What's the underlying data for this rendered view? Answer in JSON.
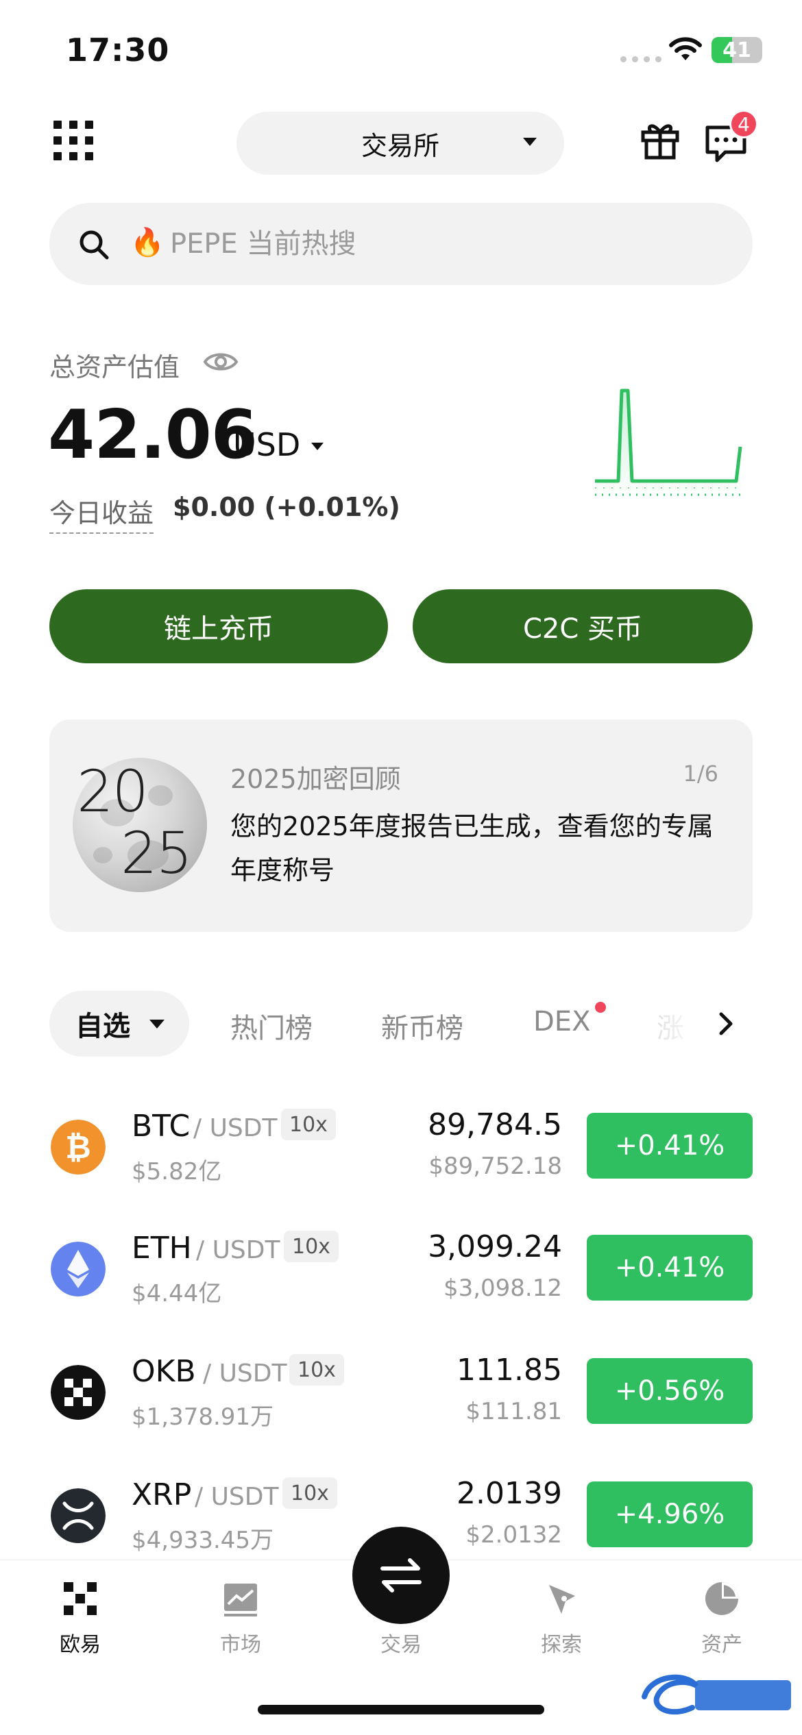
{
  "status_bar": {
    "time": "17:30",
    "battery": "41"
  },
  "header": {
    "mode_label": "交易所",
    "badge_count": "4"
  },
  "search": {
    "placeholder": "PEPE 当前热搜"
  },
  "assets": {
    "label": "总资产估值",
    "value": "42.06",
    "unit": "USD",
    "today_label": "今日收益",
    "today_value": "$0.00 (+0.01%)"
  },
  "actions": {
    "onchain_label": "链上充币",
    "c2c_label": "C2C 买币"
  },
  "promo": {
    "year_a": "20",
    "year_b": "25",
    "title": "2025加密回顾",
    "page": "1/6",
    "text": "您的2025年度报告已生成，查看您的专属年度称号"
  },
  "tabs": {
    "active": "自选",
    "items": [
      "热门榜",
      "新币榜",
      "DEX"
    ],
    "overflow": "涨"
  },
  "markets": [
    {
      "base": "BTC",
      "quote": "/ USDT",
      "leverage": "10x",
      "volume": "$5.82亿",
      "price": "89,784.5",
      "price_usd": "$89,752.18",
      "change": "+0.41%",
      "icon_color": "#f2922c"
    },
    {
      "base": "ETH",
      "quote": "/ USDT",
      "leverage": "10x",
      "volume": "$4.44亿",
      "price": "3,099.24",
      "price_usd": "$3,098.12",
      "change": "+0.41%",
      "icon_color": "#6583ee"
    },
    {
      "base": "OKB",
      "quote": "/ USDT",
      "leverage": "10x",
      "volume": "$1,378.91万",
      "price": "111.85",
      "price_usd": "$111.81",
      "change": "+0.56%",
      "icon_color": "#111111"
    },
    {
      "base": "XRP",
      "quote": "/ USDT",
      "leverage": "10x",
      "volume": "$4,933.45万",
      "price": "2.0139",
      "price_usd": "$2.0132",
      "change": "+4.96%",
      "icon_color": "#23292f"
    }
  ],
  "nav": {
    "home": "欧易",
    "market": "市场",
    "trade": "交易",
    "explore": "探索",
    "assets": "资产"
  },
  "colors": {
    "primary_green": "#2d6a1f",
    "up_green": "#2fbe60",
    "badge_red": "#f0455a"
  }
}
